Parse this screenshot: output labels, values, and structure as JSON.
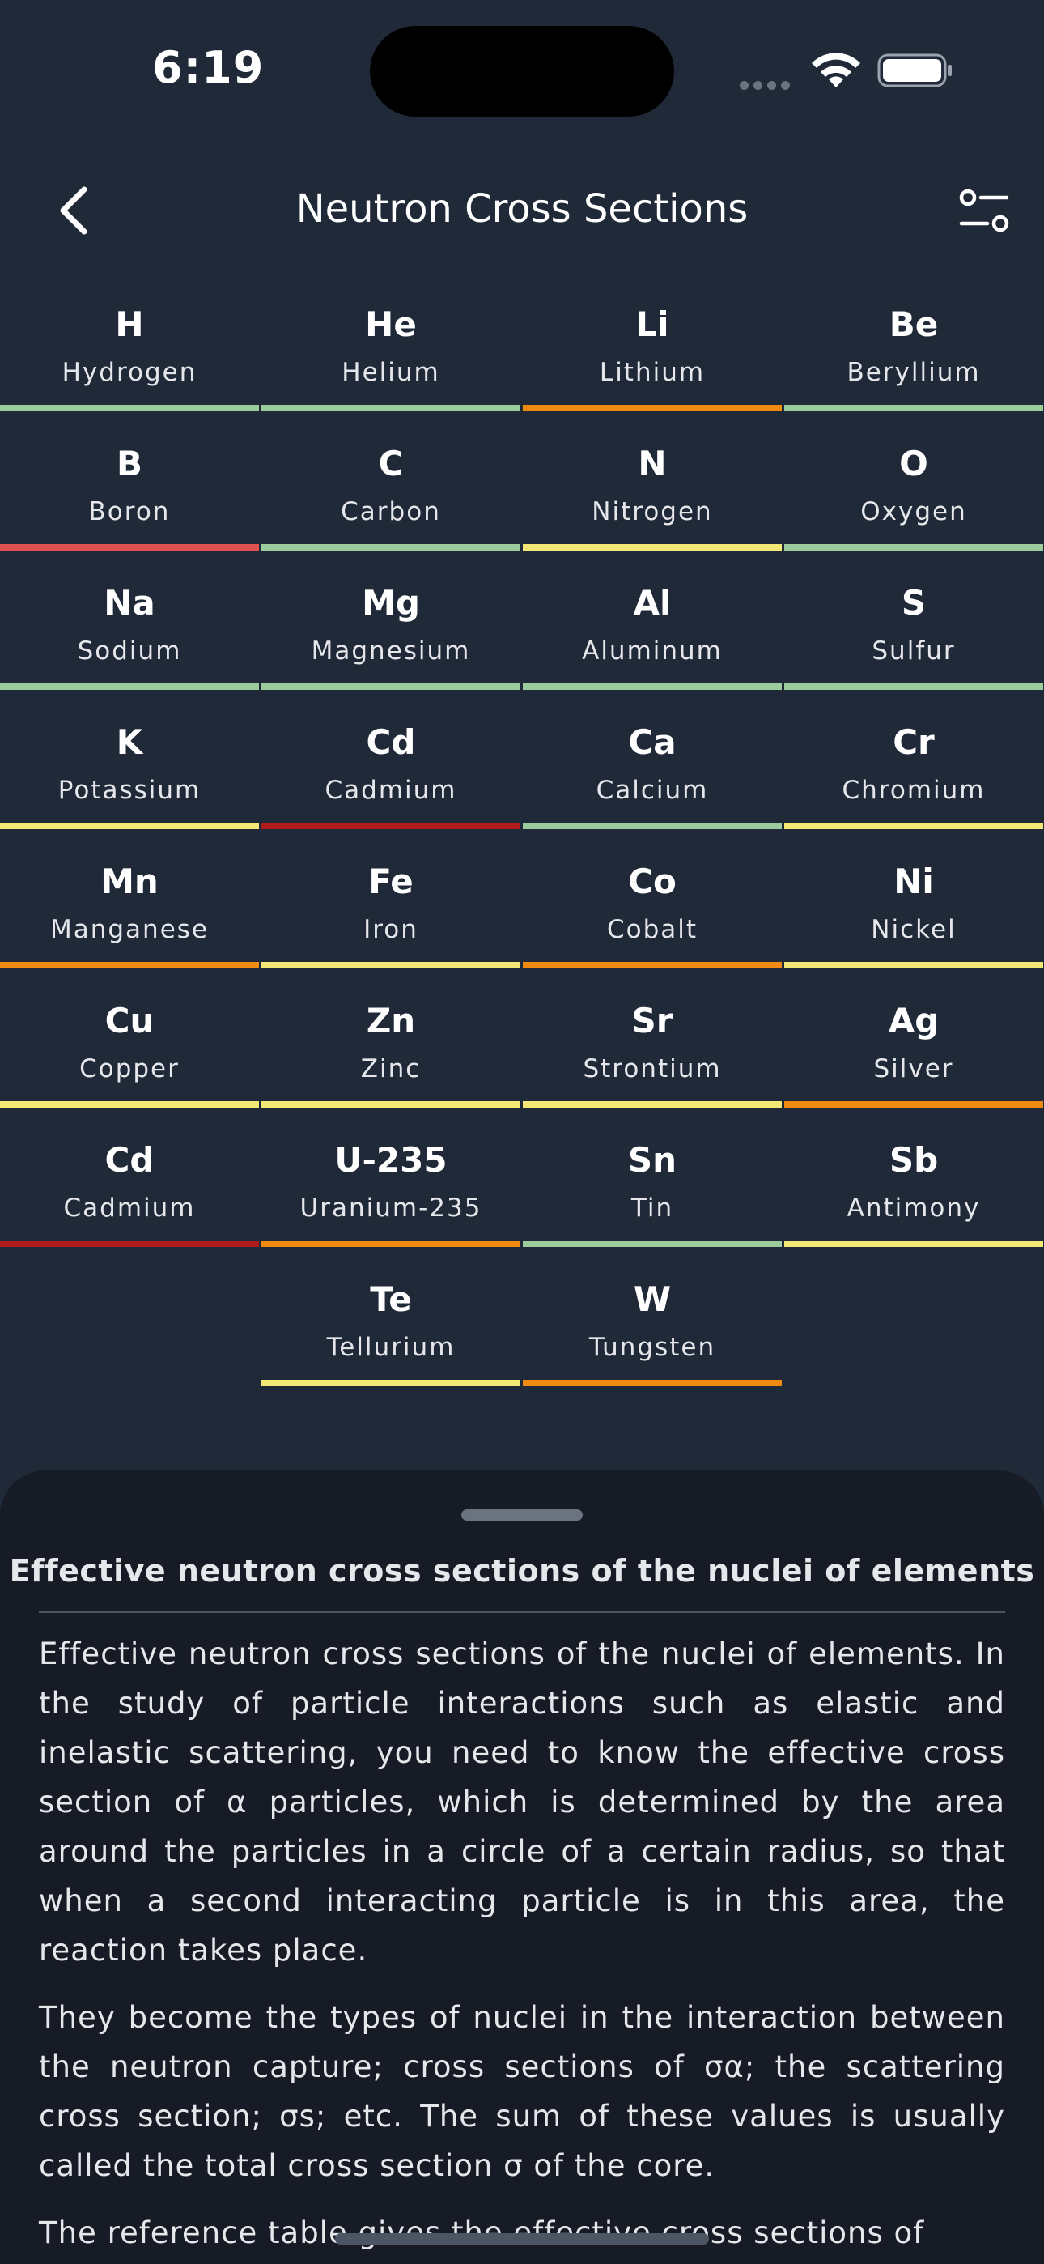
{
  "status_bar": {
    "time": "6:19"
  },
  "header": {
    "title": "Neutron Cross Sections"
  },
  "colors": {
    "background": "#1f2938",
    "sheet": "#161b25",
    "green": "#9ccb9e",
    "orange": "#f08a10",
    "yellow": "#f3e876",
    "red": "#e05252",
    "dark_red": "#b01c1c"
  },
  "elements": [
    {
      "symbol": "H",
      "name": "Hydrogen",
      "level": "green"
    },
    {
      "symbol": "He",
      "name": "Helium",
      "level": "green"
    },
    {
      "symbol": "Li",
      "name": "Lithium",
      "level": "orange"
    },
    {
      "symbol": "Be",
      "name": "Beryllium",
      "level": "green"
    },
    {
      "symbol": "B",
      "name": "Boron",
      "level": "red"
    },
    {
      "symbol": "C",
      "name": "Carbon",
      "level": "green"
    },
    {
      "symbol": "N",
      "name": "Nitrogen",
      "level": "yellow"
    },
    {
      "symbol": "O",
      "name": "Oxygen",
      "level": "green"
    },
    {
      "symbol": "Na",
      "name": "Sodium",
      "level": "green"
    },
    {
      "symbol": "Mg",
      "name": "Magnesium",
      "level": "green"
    },
    {
      "symbol": "Al",
      "name": "Aluminum",
      "level": "green"
    },
    {
      "symbol": "S",
      "name": "Sulfur",
      "level": "green"
    },
    {
      "symbol": "K",
      "name": "Potassium",
      "level": "yellow"
    },
    {
      "symbol": "Cd",
      "name": "Cadmium",
      "level": "dark_red"
    },
    {
      "symbol": "Ca",
      "name": "Calcium",
      "level": "green"
    },
    {
      "symbol": "Cr",
      "name": "Chromium",
      "level": "yellow"
    },
    {
      "symbol": "Mn",
      "name": "Manganese",
      "level": "orange"
    },
    {
      "symbol": "Fe",
      "name": "Iron",
      "level": "yellow"
    },
    {
      "symbol": "Co",
      "name": "Cobalt",
      "level": "orange"
    },
    {
      "symbol": "Ni",
      "name": "Nickel",
      "level": "yellow"
    },
    {
      "symbol": "Cu",
      "name": "Copper",
      "level": "yellow"
    },
    {
      "symbol": "Zn",
      "name": "Zinc",
      "level": "yellow"
    },
    {
      "symbol": "Sr",
      "name": "Strontium",
      "level": "yellow"
    },
    {
      "symbol": "Ag",
      "name": "Silver",
      "level": "orange"
    },
    {
      "symbol": "Cd",
      "name": "Cadmium",
      "level": "dark_red"
    },
    {
      "symbol": "U-235",
      "name": "Uranium-235",
      "level": "orange"
    },
    {
      "symbol": "Sn",
      "name": "Tin",
      "level": "green"
    },
    {
      "symbol": "Sb",
      "name": "Antimony",
      "level": "yellow"
    },
    {
      "symbol": "Te",
      "name": "Tellurium",
      "level": "yellow"
    },
    {
      "symbol": "W",
      "name": "Tungsten",
      "level": "orange"
    }
  ],
  "sheet": {
    "title": "Effective neutron cross sections of the nuclei of elements",
    "paragraphs": [
      "Effective neutron cross sections of the nuclei of elements. In the study of particle interactions such as elastic and inelastic scattering, you need to know the effective cross section of α particles, which is determined by the area around the particles in a circle of a certain radius, so that when a second interacting particle is in this area, the reaction takes place.",
      "They become the types of nuclei in the interaction between the neutron capture; cross sections of σα; the scattering cross section; σs; etc. The sum of these values is usually called the total cross section σ of the core.",
      "The reference table gives the effective cross sections of"
    ]
  }
}
